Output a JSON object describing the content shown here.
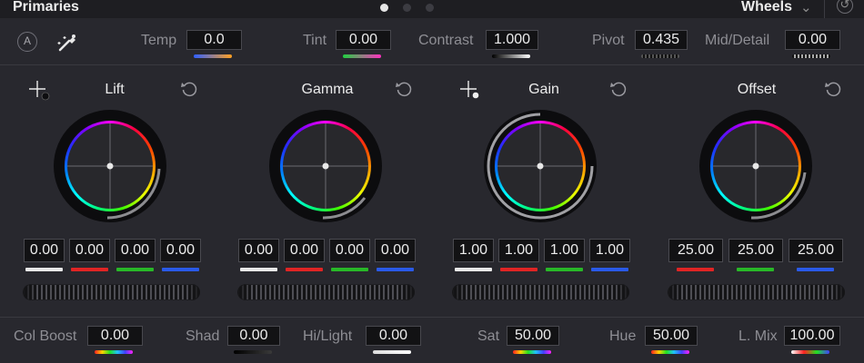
{
  "header": {
    "title": "Primaries",
    "mode_label": "Wheels",
    "page_dots": 3,
    "active_dot": 0
  },
  "adjust": {
    "auto_label": "A",
    "temp": {
      "label": "Temp",
      "value": "0.0"
    },
    "tint": {
      "label": "Tint",
      "value": "0.00"
    },
    "contrast": {
      "label": "Contrast",
      "value": "1.000"
    },
    "pivot": {
      "label": "Pivot",
      "value": "0.435"
    },
    "mid_detail": {
      "label": "Mid/Detail",
      "value": "0.00"
    }
  },
  "wheels": [
    {
      "name": "Lift",
      "values": [
        "0.00",
        "0.00",
        "0.00",
        "0.00"
      ]
    },
    {
      "name": "Gamma",
      "values": [
        "0.00",
        "0.00",
        "0.00",
        "0.00"
      ]
    },
    {
      "name": "Gain",
      "values": [
        "1.00",
        "1.00",
        "1.00",
        "1.00"
      ]
    },
    {
      "name": "Offset",
      "values": [
        "25.00",
        "25.00",
        "25.00"
      ]
    }
  ],
  "bottom": {
    "col_boost": {
      "label": "Col Boost",
      "value": "0.00"
    },
    "shad": {
      "label": "Shad",
      "value": "0.00"
    },
    "hi_light": {
      "label": "Hi/Light",
      "value": "0.00"
    },
    "sat": {
      "label": "Sat",
      "value": "50.00"
    },
    "hue": {
      "label": "Hue",
      "value": "50.00"
    },
    "l_mix": {
      "label": "L. Mix",
      "value": "100.00"
    }
  },
  "colors": {
    "white": "#e8e8e8",
    "red": "#e02424",
    "green": "#28b828",
    "blue": "#2a5ae8",
    "panel": "#28282e",
    "field": "#121214"
  }
}
